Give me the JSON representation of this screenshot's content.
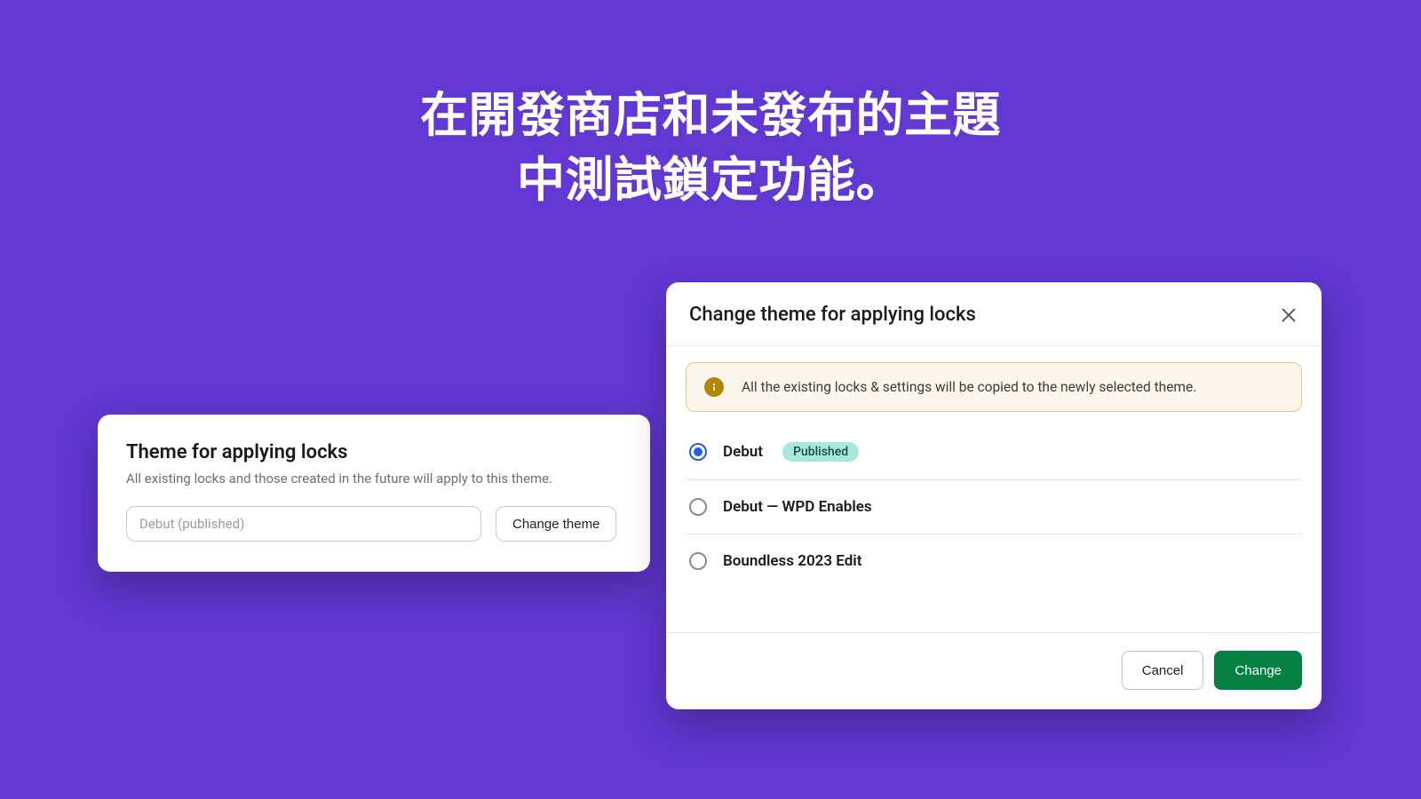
{
  "hero": {
    "line1": "在開發商店和未發布的主題",
    "line2": "中測試鎖定功能。"
  },
  "leftCard": {
    "title": "Theme for applying locks",
    "subtitle": "All existing locks and those created in the future will apply to this theme.",
    "inputValue": "Debut (published)",
    "changeButton": "Change theme"
  },
  "modal": {
    "title": "Change theme for applying locks",
    "alert": "All the existing locks & settings will be copied to the newly selected theme.",
    "options": [
      {
        "label": "Debut",
        "badge": "Published",
        "selected": true
      },
      {
        "label": "Debut — WPD Enables",
        "selected": false
      },
      {
        "label": "Boundless 2023 Edit",
        "selected": false
      }
    ],
    "cancel": "Cancel",
    "confirm": "Change"
  }
}
